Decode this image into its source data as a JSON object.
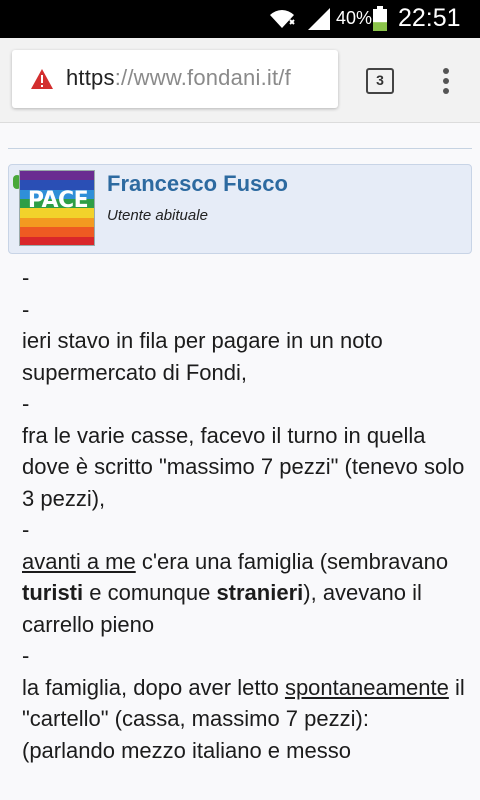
{
  "status_bar": {
    "battery_percent": "40%",
    "battery_level": 0.4,
    "time": "22:51",
    "icons": [
      "wifi-icon",
      "signal-icon",
      "battery-icon"
    ]
  },
  "browser": {
    "url_scheme": "https",
    "url_rest": "://www.fondani.it/f",
    "tab_count": "3",
    "warning_icon": "warning-icon",
    "menu_icon": "more-vert-icon"
  },
  "profile": {
    "avatar_text": "PACE",
    "username": "Francesco Fusco",
    "usertitle": "Utente abituale"
  },
  "post": {
    "l1": "-",
    "l2": "-",
    "l3": "ieri stavo in fila per pagare in un noto supermercato di Fondi,",
    "l4": "-",
    "l5": "fra le varie casse, facevo il turno in quella dove è scritto \"massimo 7 pezzi\" (tenevo solo 3 pezzi),",
    "l6": "-",
    "l7_link": "avanti a me",
    "l7_a": " c'era una famiglia (sembravano ",
    "l7_bold1": "turisti",
    "l7_b": " e comunque ",
    "l7_bold2": "stranieri",
    "l7_c": "), avevano il carrello pieno",
    "l8": "-",
    "l9_a": "la famiglia, dopo aver letto ",
    "l9_link": "spontaneamente",
    "l9_b": " il \"cartello\" (cassa, massimo 7 pezzi):",
    "l10": "(parlando mezzo italiano e messo"
  },
  "colors": {
    "username": "#2d6aa0",
    "profile_bg": "#e6ecf7",
    "status_bar": "#000000",
    "warning": "#d32f2f",
    "battery_fill": "#8bc34a"
  }
}
